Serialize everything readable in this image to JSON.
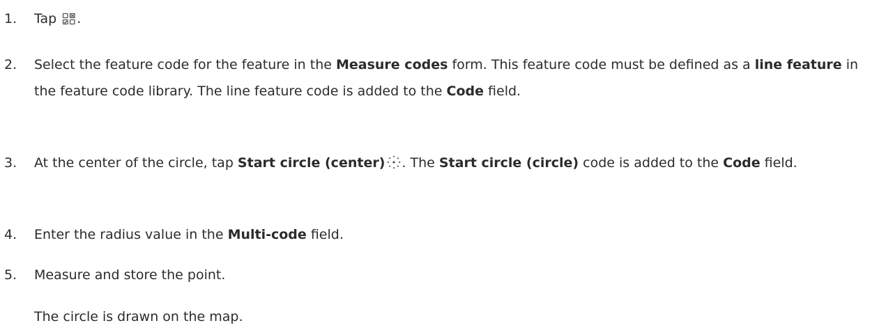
{
  "steps": [
    {
      "number": "1.",
      "parts": {
        "a": "Tap",
        "icon": "measure-codes-icon",
        "b": "."
      }
    },
    {
      "number": "2.",
      "parts": {
        "a": "Select the feature code for the feature in the ",
        "b": "Measure codes",
        "c": " form. This feature code must be defined as a ",
        "d": "line feature",
        "e": " in the feature code library. The line feature code is added to the ",
        "f": "Code",
        "g": " field."
      }
    },
    {
      "number": "3.",
      "parts": {
        "a": "At the center of the circle, tap ",
        "b": "Start circle (center)",
        "icon": "start-circle-center-icon",
        "c": ". The ",
        "d": "Start circle (circle)",
        "e": " code is added to the ",
        "f": "Code",
        "g": " field."
      }
    },
    {
      "number": "4.",
      "parts": {
        "a": "Enter the radius value in the ",
        "b": "Multi-code",
        "c": " field."
      }
    },
    {
      "number": "5.",
      "parts": {
        "a": "Measure and store the point."
      }
    }
  ],
  "result": "The circle is drawn on the map.",
  "colors": {
    "text": "#2b2b2b",
    "icon": "#555555"
  }
}
